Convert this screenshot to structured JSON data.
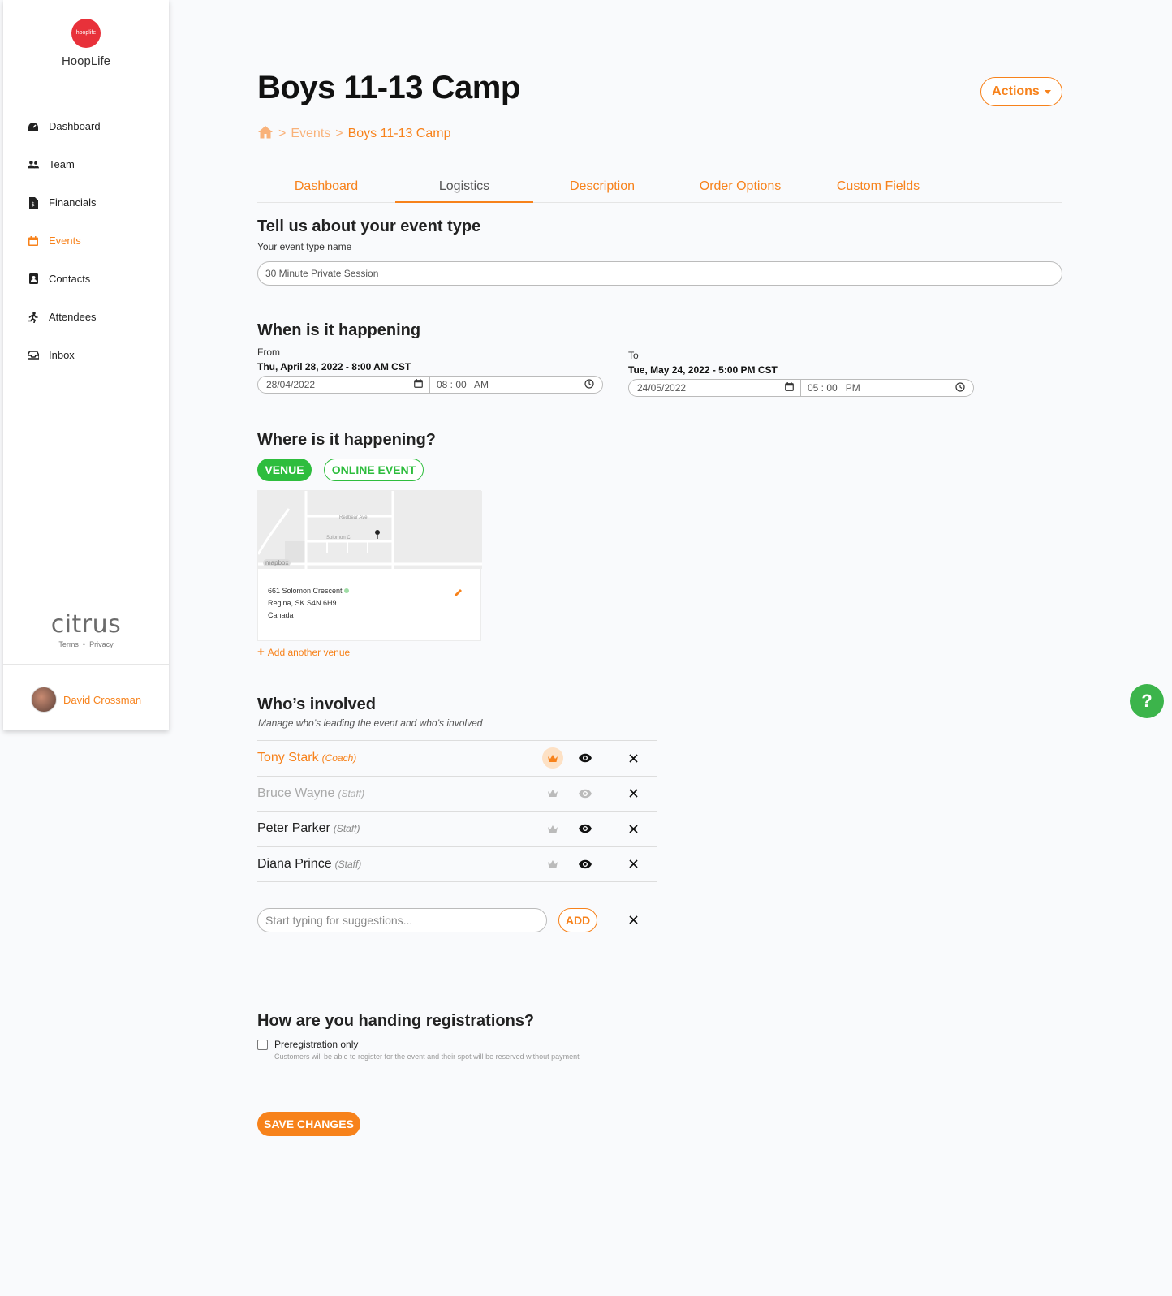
{
  "brand": {
    "logo_text": "hooplife",
    "name": "HoopLife"
  },
  "sidebar": {
    "items": [
      {
        "label": "Dashboard",
        "icon": "dashboard-icon"
      },
      {
        "label": "Team",
        "icon": "team-icon"
      },
      {
        "label": "Financials",
        "icon": "financials-icon"
      },
      {
        "label": "Events",
        "icon": "calendar-icon",
        "active": true
      },
      {
        "label": "Contacts",
        "icon": "contacts-icon"
      },
      {
        "label": "Attendees",
        "icon": "running-icon"
      },
      {
        "label": "Inbox",
        "icon": "inbox-icon"
      }
    ],
    "footer": {
      "logo": "citrus",
      "terms": "Terms",
      "dot": "•",
      "privacy": "Privacy"
    },
    "user": {
      "name": "David Crossman"
    }
  },
  "header": {
    "title": "Boys 11-13 Camp",
    "actions_label": "Actions",
    "breadcrumb": {
      "sep": ">",
      "events": "Events",
      "current": "Boys 11-13 Camp"
    }
  },
  "tabs": [
    {
      "label": "Dashboard"
    },
    {
      "label": "Logistics",
      "active": true
    },
    {
      "label": "Description"
    },
    {
      "label": "Order Options"
    },
    {
      "label": "Custom Fields"
    }
  ],
  "event_type": {
    "heading": "Tell us about your event type",
    "label": "Your event type name",
    "value": "30 Minute Private Session"
  },
  "when": {
    "heading": "When is it happening",
    "from": {
      "label": "From",
      "summary": "Thu, April 28, 2022 - 8:00 AM CST",
      "date": "28/04/2022",
      "time": "08 : 00   AM"
    },
    "to": {
      "label": "To",
      "summary": "Tue, May 24, 2022 - 5:00 PM CST",
      "date": "24/05/2022",
      "time": "05 : 00   PM"
    }
  },
  "where": {
    "heading": "Where is it happening?",
    "venue_label": "VENUE",
    "online_label": "ONLINE EVENT",
    "map": {
      "street1": "Redbear Ave",
      "street2": "Solomon Cr",
      "attribution": "mapbox"
    },
    "address": {
      "line1": "661 Solomon Crescent",
      "line2": "Regina, SK S4N 6H9",
      "line3": "Canada"
    },
    "add_venue_label": "Add another venue"
  },
  "involved": {
    "heading": "Who’s involved",
    "subtitle": "Manage who’s leading the event and who’s involved",
    "people": [
      {
        "name": "Tony Stark",
        "role": "(Coach)"
      },
      {
        "name": "Bruce Wayne",
        "role": "(Staff)"
      },
      {
        "name": "Peter Parker",
        "role": "(Staff)"
      },
      {
        "name": "Diana Prince",
        "role": "(Staff)"
      }
    ],
    "suggest_placeholder": "Start typing for suggestions...",
    "add_label": "ADD"
  },
  "registration": {
    "heading": "How are you handing registrations?",
    "checkbox_label": "Preregistration only",
    "checkbox_help": "Customers will be able to register for the event and their spot will be reserved without payment"
  },
  "save_label": "SAVE CHANGES",
  "help_label": "?",
  "colors": {
    "accent": "#f7821b",
    "green": "#2ebd3d",
    "brand_red": "#e8313a"
  }
}
